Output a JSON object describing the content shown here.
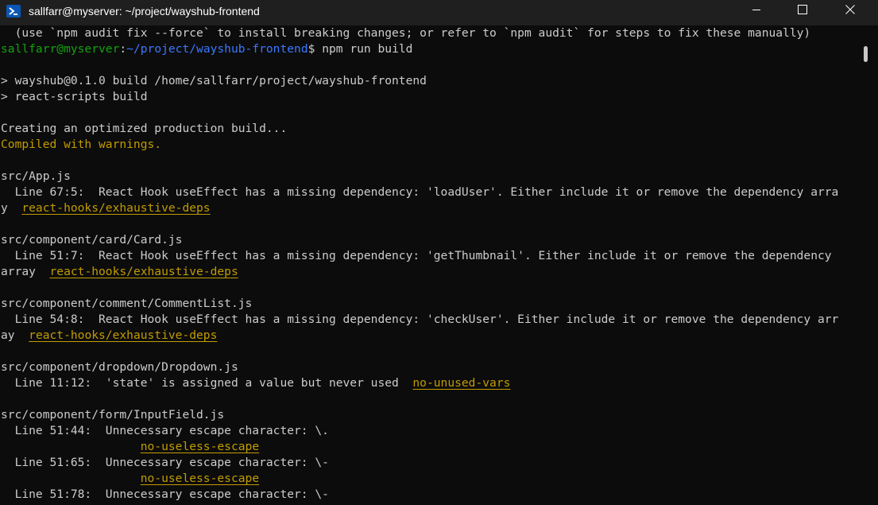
{
  "window": {
    "title": "sallfarr@myserver: ~/project/wayshub-frontend"
  },
  "icons": {
    "app": "powershell-terminal-icon",
    "minimize": "minimize-icon",
    "maximize": "maximize-icon",
    "close": "close-icon"
  },
  "colors": {
    "background": "#0c0c0c",
    "text": "#cccccc",
    "prompt_user": "#13a10e",
    "prompt_path": "#3b78ff",
    "warning": "#c19c00"
  },
  "terminal": {
    "lines": [
      {
        "text": "  (use `npm audit fix --force` to install breaking changes; or refer to `npm audit` for steps to fix these manually)"
      },
      {
        "prompt_user": "sallfarr@myserver",
        "prompt_sep": ":",
        "prompt_path": "~/project/wayshub-frontend",
        "prompt_symbol": "$ ",
        "command": "npm run build"
      },
      {
        "text": ""
      },
      {
        "text": "> wayshub@0.1.0 build /home/sallfarr/project/wayshub-frontend"
      },
      {
        "text": "> react-scripts build"
      },
      {
        "text": ""
      },
      {
        "text": "Creating an optimized production build..."
      },
      {
        "warn": "Compiled with warnings."
      },
      {
        "text": ""
      },
      {
        "text": "src/App.js"
      },
      {
        "text": "  Line 67:5:  React Hook useEffect has a missing dependency: 'loadUser'. Either include it or remove the dependency arra"
      },
      {
        "text": "y  ",
        "link": "react-hooks/exhaustive-deps"
      },
      {
        "text": ""
      },
      {
        "text": "src/component/card/Card.js"
      },
      {
        "text": "  Line 51:7:  React Hook useEffect has a missing dependency: 'getThumbnail'. Either include it or remove the dependency"
      },
      {
        "text": "array  ",
        "link": "react-hooks/exhaustive-deps"
      },
      {
        "text": ""
      },
      {
        "text": "src/component/comment/CommentList.js"
      },
      {
        "text": "  Line 54:8:  React Hook useEffect has a missing dependency: 'checkUser'. Either include it or remove the dependency arr"
      },
      {
        "text": "ay  ",
        "link": "react-hooks/exhaustive-deps"
      },
      {
        "text": ""
      },
      {
        "text": "src/component/dropdown/Dropdown.js"
      },
      {
        "text": "  Line 11:12:  'state' is assigned a value but never used  ",
        "link": "no-unused-vars"
      },
      {
        "text": ""
      },
      {
        "text": "src/component/form/InputField.js"
      },
      {
        "text": "  Line 51:44:  Unnecessary escape character: \\."
      },
      {
        "text": "                    ",
        "link": "no-useless-escape"
      },
      {
        "text": "  Line 51:65:  Unnecessary escape character: \\-"
      },
      {
        "text": "                    ",
        "link": "no-useless-escape"
      },
      {
        "text": "  Line 51:78:  Unnecessary escape character: \\-"
      }
    ]
  }
}
